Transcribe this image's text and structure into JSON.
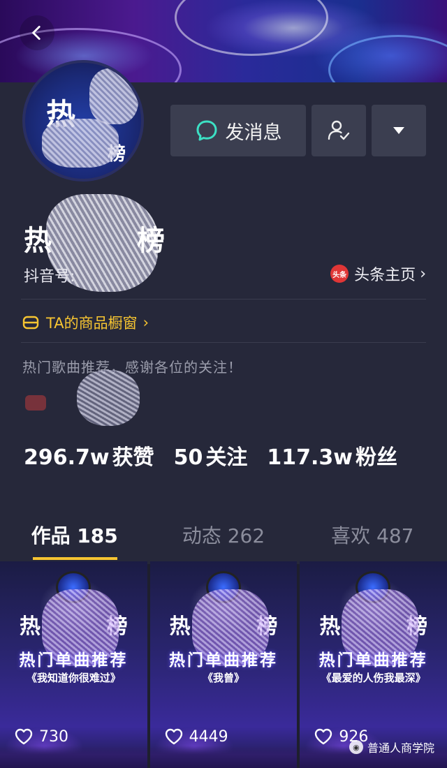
{
  "header": {
    "back_icon": "chevron-left-icon"
  },
  "profile": {
    "avatar_text_top": "热",
    "avatar_text_bottom": "榜",
    "name_start": "热",
    "name_end": "榜",
    "douyin_id_label": "抖音号:",
    "toutiao_badge": "头条",
    "toutiao_link": "头条主页",
    "shop_link": "TA的商品橱窗",
    "bio": "热门歌曲推荐，感谢各位的关注！"
  },
  "actions": {
    "message_label": "发消息",
    "message_icon": "chat-bubble-icon",
    "follow_icon": "user-check-icon",
    "more_icon": "caret-down-icon"
  },
  "stats": [
    {
      "num": "296.7w",
      "label": "获赞"
    },
    {
      "num": "50",
      "label": "关注"
    },
    {
      "num": "117.3w",
      "label": "粉丝"
    }
  ],
  "tabs": [
    {
      "label": "作品 185",
      "active": true
    },
    {
      "label": "动态 262",
      "active": false
    },
    {
      "label": "喜欢 487",
      "active": false
    }
  ],
  "videos": [
    {
      "title_start": "热",
      "title_end": "榜",
      "tag": "热门单曲推荐",
      "song": "《我知道你很难过》",
      "likes": "730"
    },
    {
      "title_start": "热",
      "title_end": "榜",
      "tag": "热门单曲推荐",
      "song": "《我曾》",
      "likes": "4449"
    },
    {
      "title_start": "热",
      "title_end": "榜",
      "tag": "热门单曲推荐",
      "song": "《最爱的人伤我最深》",
      "likes": "926"
    }
  ],
  "watermark": "普通人商学院",
  "colors": {
    "accent": "#f7c531",
    "panel": "#26283a",
    "button": "#3b3e50",
    "chat_icon": "#3ce0c4",
    "toutiao_red": "#e03636"
  }
}
